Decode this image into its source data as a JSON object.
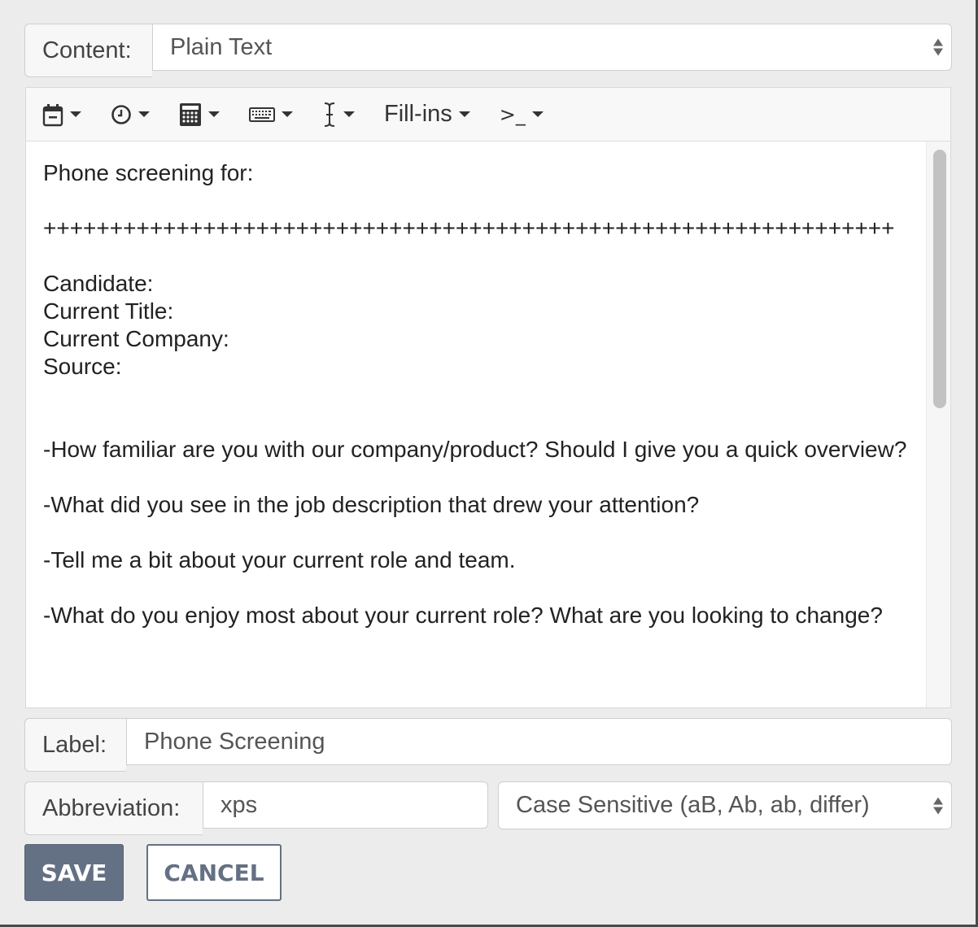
{
  "content": {
    "label": "Content:",
    "selected": "Plain Text"
  },
  "toolbar": {
    "buttons": [
      {
        "icon": "calendar-icon"
      },
      {
        "icon": "clock-icon"
      },
      {
        "icon": "calculator-icon"
      },
      {
        "icon": "keyboard-icon"
      },
      {
        "icon": "text-cursor-icon"
      },
      {
        "label": "Fill-ins"
      },
      {
        "icon": "terminal-icon",
        "glyph": ">_"
      }
    ]
  },
  "editor": {
    "text": "Phone screening for:\n\n++++++++++++++++++++++++++++++++++++++++++++++++++++++++++++++++\n\nCandidate:\nCurrent Title:\nCurrent Company:\nSource:\n\n\n-How familiar are you with our company/product? Should I give you a quick overview?\n\n-What did you see in the job description that drew your attention?\n\n-Tell me a bit about your current role and team.\n\n-What do you enjoy most about your current role? What are you looking to change?\n"
  },
  "label_field": {
    "label": "Label:",
    "value": "Phone Screening"
  },
  "abbreviation_field": {
    "label": "Abbreviation:",
    "value": "xps"
  },
  "case_select": {
    "selected": "Case Sensitive (aB, Ab, ab, differ)"
  },
  "actions": {
    "save": "SAVE",
    "cancel": "CANCEL"
  }
}
